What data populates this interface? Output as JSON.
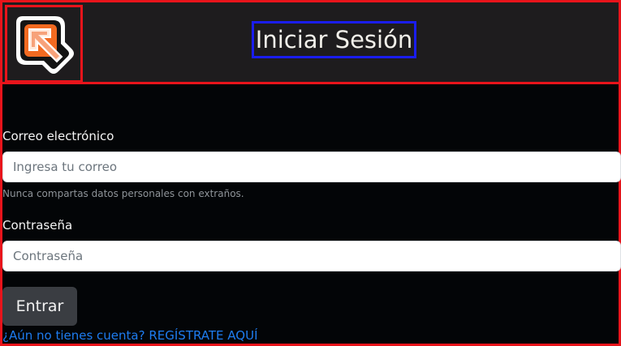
{
  "header": {
    "logo_icon": "arrow-up-left-logo-icon",
    "title": "Iniciar Sesión"
  },
  "form": {
    "email": {
      "label": "Correo electrónico",
      "placeholder": "Ingresa tu correo",
      "help": "Nunca compartas datos personales con extraños."
    },
    "password": {
      "label": "Contraseña",
      "placeholder": "Contraseña"
    },
    "submit_label": "Entrar",
    "register_link": "¿Aún no tienes cuenta? REGÍSTRATE AQUÍ"
  },
  "colors": {
    "accent_border": "#e8141b",
    "title_border": "#1a1df0",
    "link": "#1e7cf0",
    "button": "#3a3d42",
    "logo_orange": "#f26a21"
  }
}
